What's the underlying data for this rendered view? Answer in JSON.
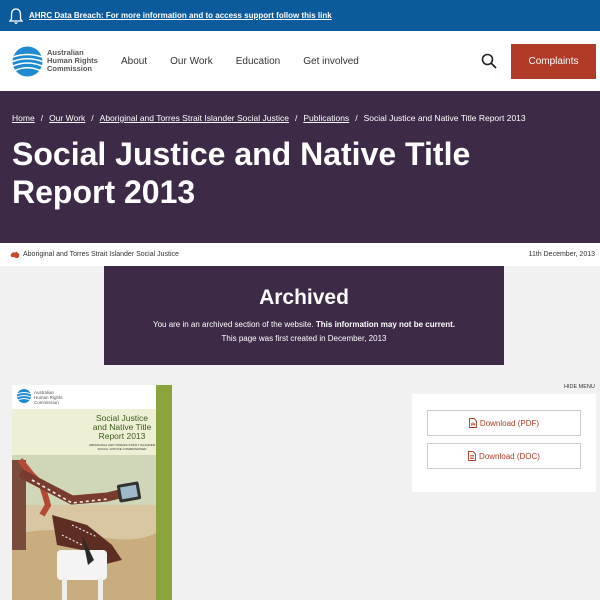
{
  "alert": {
    "text": "AHRC Data Breach: For more information and to access support follow this link"
  },
  "header": {
    "logo_lines": [
      "Australian",
      "Human Rights",
      "Commission"
    ],
    "nav": [
      {
        "label": "About"
      },
      {
        "label": "Our Work"
      },
      {
        "label": "Education"
      },
      {
        "label": "Get involved"
      }
    ],
    "complaints_label": "Complaints"
  },
  "breadcrumb": {
    "items": [
      "Home",
      "Our Work",
      "Aboriginal and Torres Strait Islander Social Justice",
      "Publications"
    ],
    "current": "Social Justice and Native Title Report 2013",
    "separator": "/"
  },
  "page": {
    "title": "Social Justice and Native Title Report 2013",
    "category": "Aboriginal and Torres Strait Islander Social Justice",
    "date": "11th December, 2013"
  },
  "archived": {
    "heading": "Archived",
    "notice": "You are in an archived section of the website.",
    "notice_bold": "This information may not be current.",
    "created": "This page was first created in December, 2013"
  },
  "cover": {
    "logo_lines": [
      "Australian",
      "Human Rights",
      "Commission"
    ],
    "title_lines": [
      "Social Justice",
      "and Native Title",
      "Report 2013"
    ],
    "subtitle_lines": [
      "ABORIGINAL AND TORRES STRAIT ISLANDER",
      "SOCIAL JUSTICE COMMISSIONER"
    ]
  },
  "side_menu": {
    "hide_label": "HIDE MENU",
    "downloads": [
      {
        "label": "Download (PDF)"
      },
      {
        "label": "Download (DOC)"
      }
    ]
  },
  "colors": {
    "brand_blue": "#0b5a9b",
    "purple": "#3c2a46",
    "accent_red": "#b03b26"
  }
}
